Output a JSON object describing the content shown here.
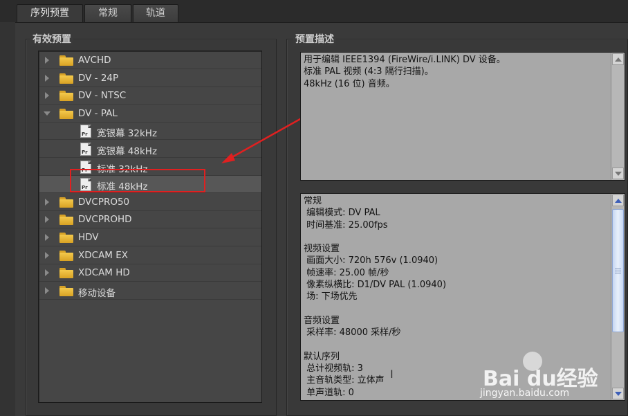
{
  "tabs": [
    {
      "label": "序列预置",
      "active": true
    },
    {
      "label": "常规",
      "active": false
    },
    {
      "label": "轨道",
      "active": false
    }
  ],
  "left_group": {
    "title": "有效预置",
    "tree": [
      {
        "label": "AVCHD",
        "type": "folder",
        "expanded": false
      },
      {
        "label": "DV - 24P",
        "type": "folder",
        "expanded": false
      },
      {
        "label": "DV - NTSC",
        "type": "folder",
        "expanded": false
      },
      {
        "label": "DV - PAL",
        "type": "folder",
        "expanded": true
      },
      {
        "label": "宽银幕 32kHz",
        "type": "preset"
      },
      {
        "label": "宽银幕 48kHz",
        "type": "preset"
      },
      {
        "label": "标准 32kHz",
        "type": "preset"
      },
      {
        "label": "标准 48kHz",
        "type": "preset",
        "selected": true
      },
      {
        "label": "DVCPRO50",
        "type": "folder",
        "expanded": false
      },
      {
        "label": "DVCPROHD",
        "type": "folder",
        "expanded": false
      },
      {
        "label": "HDV",
        "type": "folder",
        "expanded": false
      },
      {
        "label": "XDCAM EX",
        "type": "folder",
        "expanded": false
      },
      {
        "label": "XDCAM HD",
        "type": "folder",
        "expanded": false
      },
      {
        "label": "移动设备",
        "type": "folder",
        "expanded": false
      }
    ],
    "preset_icon_text": "Pr"
  },
  "right_group": {
    "title": "预置描述",
    "description": "用于编辑 IEEE1394 (FireWire/i.LINK) DV 设备。\n标准 PAL 视频 (4:3 隔行扫描)。\n48kHz (16 位) 音频。",
    "info": "常规\n 编辑模式: DV PAL\n 时间基准: 25.00fps\n\n视频设置\n 画面大小: 720h 576v (1.0940)\n 帧速率: 25.00 帧/秒\n 像素纵横比: D1/DV PAL (1.0940)\n 场: 下场优先\n\n音频设置\n 采样率: 48000 采样/秒\n\n默认序列\n 总计视频轨: 3\n 主音轨类型: 立体声\n 单声道轨: 0"
  },
  "watermark": {
    "logo": "Bai  du经验",
    "url": "jingyan.baidu.com"
  },
  "colors": {
    "annotation_red": "#e02020",
    "folder_yellow": "#f3c94c"
  }
}
